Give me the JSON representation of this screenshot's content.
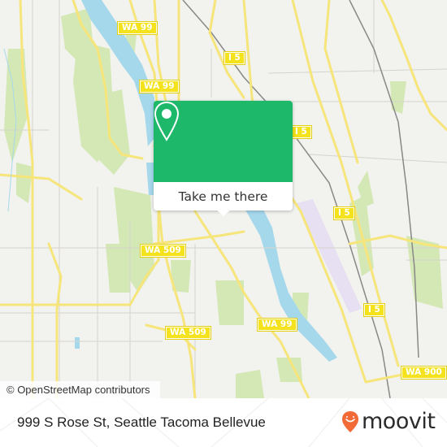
{
  "map": {
    "attribution": "© OpenStreetMap contributors",
    "route_shields": [
      {
        "id": "wa99-a",
        "label": "WA 99"
      },
      {
        "id": "wa99-b",
        "label": "WA 99"
      },
      {
        "id": "i5-a",
        "label": "I 5"
      },
      {
        "id": "i5-b",
        "label": "I 5"
      },
      {
        "id": "i5-c",
        "label": "I 5"
      },
      {
        "id": "i5-d",
        "label": "I 5"
      },
      {
        "id": "wa509-a",
        "label": "WA 509"
      },
      {
        "id": "wa509-b",
        "label": "WA 509"
      },
      {
        "id": "wa99-c",
        "label": "WA 99"
      },
      {
        "id": "wa900",
        "label": "WA 900"
      }
    ],
    "colors": {
      "land": "#f2f2ee",
      "water": "#a6d8ec",
      "park": "#d4e8b5",
      "road_major": "#f6e57a",
      "airport": "#e7dff2"
    }
  },
  "popup": {
    "icon": "location-pin-icon",
    "action_label": "Take me there",
    "color": "#1db86a"
  },
  "footer": {
    "address": "999 S Rose St, Seattle Tacoma Bellevue",
    "brand": "moovit",
    "brand_color": "#f26a36"
  }
}
